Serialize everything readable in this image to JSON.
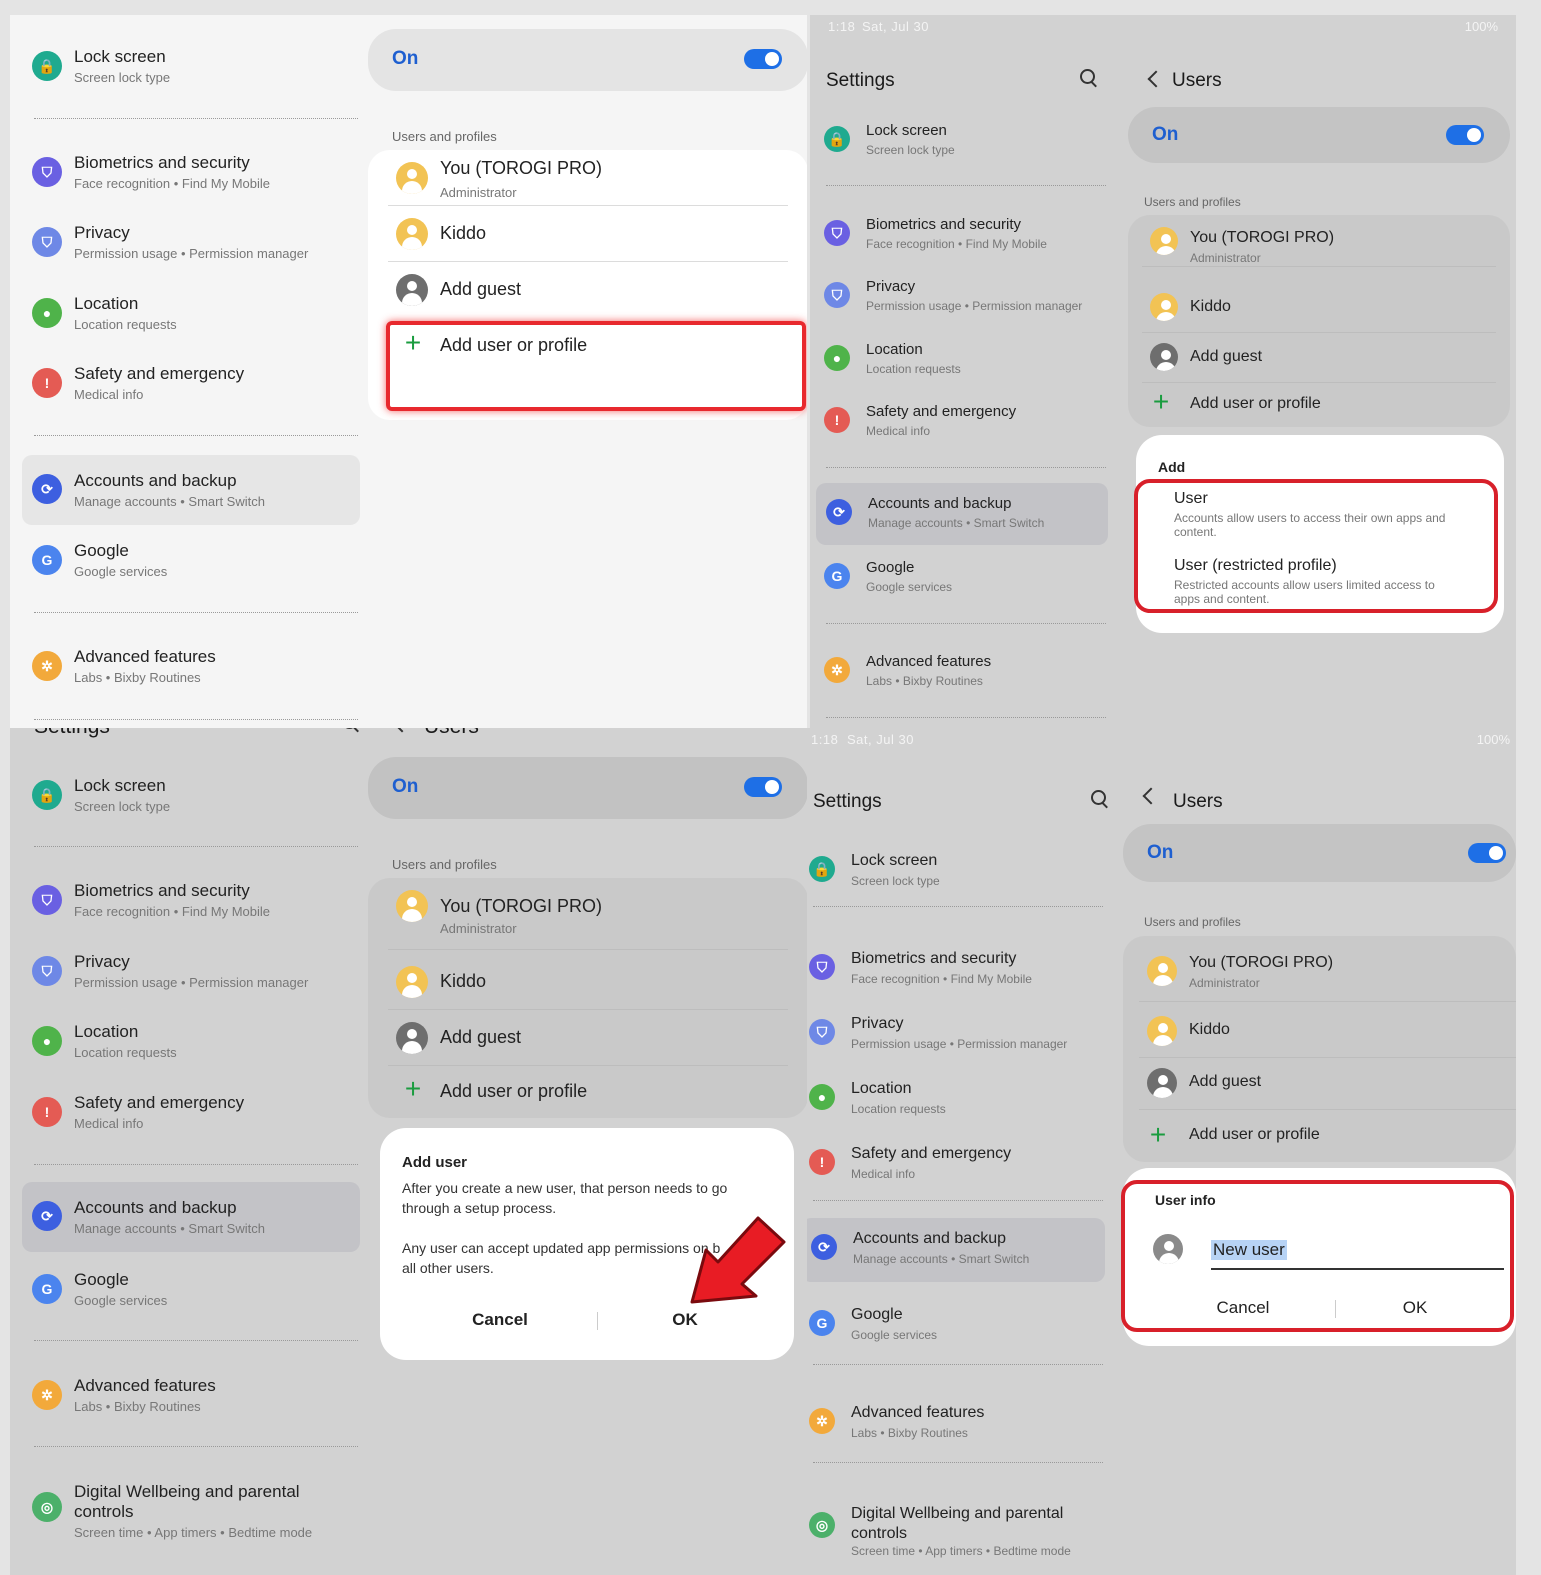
{
  "status": {
    "time": "1:18",
    "date": "Sat, Jul 30",
    "battery": "100%"
  },
  "settings": {
    "title": "Settings",
    "search_icon": "search-icon",
    "items": [
      {
        "title": "Lock screen",
        "sub": "Screen lock type",
        "color": "#1faa8f",
        "glyph": "🔒"
      },
      {
        "title": "Biometrics and security",
        "sub": "Face recognition  •  Find My Mobile",
        "color": "#6a60e2",
        "glyph": "⛉"
      },
      {
        "title": "Privacy",
        "sub": "Permission usage  •  Permission manager",
        "color": "#6e88e6",
        "glyph": "⛉"
      },
      {
        "title": "Location",
        "sub": "Location requests",
        "color": "#4fb34a",
        "glyph": "●"
      },
      {
        "title": "Safety and emergency",
        "sub": "Medical info",
        "color": "#e45b54",
        "glyph": "!"
      },
      {
        "title": "Accounts and backup",
        "sub": "Manage accounts  •  Smart Switch",
        "color": "#3d5fe0",
        "glyph": "⟳"
      },
      {
        "title": "Google",
        "sub": "Google services",
        "color": "#4b84ee",
        "glyph": "G"
      },
      {
        "title": "Advanced features",
        "sub": "Labs  •  Bixby Routines",
        "color": "#f2a93b",
        "glyph": "✲"
      },
      {
        "title": "Digital Wellbeing and parental controls",
        "sub": "Screen time  •  App timers  •  Bedtime mode",
        "color": "#4cb06a",
        "glyph": "◎"
      }
    ]
  },
  "users": {
    "title": "Users",
    "toggle_label": "On",
    "section_label": "Users and profiles",
    "rows": [
      {
        "name": "You (TOROGI PRO)",
        "role": "Administrator"
      },
      {
        "name": "Kiddo"
      },
      {
        "name": "Add guest"
      },
      {
        "name": "Add user or profile"
      }
    ]
  },
  "add_menu": {
    "title": "Add",
    "options": [
      {
        "title": "User",
        "desc": "Accounts allow users to access their own apps and content."
      },
      {
        "title": "User (restricted profile)",
        "desc": "Restricted accounts allow users limited access to apps and content."
      }
    ]
  },
  "add_user_dialog": {
    "title": "Add user",
    "text1": "After you create a new user, that person needs to go through a setup process.",
    "text2": "Any user can accept updated app permissions on behalf of all other users.",
    "text2_visible": "Any user can accept updated app permissions on b",
    "text2_end": "all other users.",
    "cancel": "Cancel",
    "ok": "OK"
  },
  "user_info_dialog": {
    "title": "User info",
    "value": "New user",
    "cancel": "Cancel",
    "ok": "OK"
  },
  "colors": {
    "accent": "#1e6fe6",
    "highlight": "#e8292e"
  }
}
